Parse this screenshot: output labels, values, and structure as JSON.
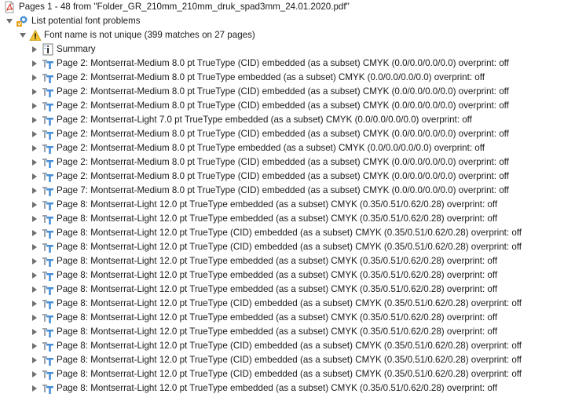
{
  "header": {
    "title": "Pages 1 - 48 from \"Folder_GR_210mm_210mm_druk_spad3mm_24.01.2020.pdf\""
  },
  "check": {
    "label": "List potential font problems"
  },
  "group": {
    "label": "Font name is not unique (399 matches on 27 pages)"
  },
  "summary": {
    "label": "Summary"
  },
  "items": [
    {
      "label": "Page 2: Montserrat-Medium 8.0 pt TrueType (CID)  embedded (as a subset) CMYK (0.0/0.0/0.0/0.0)  overprint: off"
    },
    {
      "label": "Page 2: Montserrat-Medium 8.0 pt TrueType  embedded (as a subset) CMYK (0.0/0.0/0.0/0.0)  overprint: off"
    },
    {
      "label": "Page 2: Montserrat-Medium 8.0 pt TrueType (CID)  embedded (as a subset) CMYK (0.0/0.0/0.0/0.0)  overprint: off"
    },
    {
      "label": "Page 2: Montserrat-Medium 8.0 pt TrueType (CID)  embedded (as a subset) CMYK (0.0/0.0/0.0/0.0)  overprint: off"
    },
    {
      "label": "Page 2: Montserrat-Light 7.0 pt TrueType  embedded (as a subset) CMYK (0.0/0.0/0.0/0.0)  overprint: off"
    },
    {
      "label": "Page 2: Montserrat-Medium 8.0 pt TrueType (CID)  embedded (as a subset) CMYK (0.0/0.0/0.0/0.0)  overprint: off"
    },
    {
      "label": "Page 2: Montserrat-Medium 8.0 pt TrueType  embedded (as a subset) CMYK (0.0/0.0/0.0/0.0)  overprint: off"
    },
    {
      "label": "Page 2: Montserrat-Medium 8.0 pt TrueType (CID)  embedded (as a subset) CMYK (0.0/0.0/0.0/0.0)  overprint: off"
    },
    {
      "label": "Page 2: Montserrat-Medium 8.0 pt TrueType (CID)  embedded (as a subset) CMYK (0.0/0.0/0.0/0.0)  overprint: off"
    },
    {
      "label": "Page 7: Montserrat-Medium 8.0 pt TrueType (CID)  embedded (as a subset) CMYK (0.0/0.0/0.0/0.0)  overprint: off"
    },
    {
      "label": "Page 8: Montserrat-Light 12.0 pt TrueType  embedded (as a subset) CMYK (0.35/0.51/0.62/0.28)  overprint: off"
    },
    {
      "label": "Page 8: Montserrat-Light 12.0 pt TrueType  embedded (as a subset) CMYK (0.35/0.51/0.62/0.28)  overprint: off"
    },
    {
      "label": "Page 8: Montserrat-Light 12.0 pt TrueType (CID)  embedded (as a subset) CMYK (0.35/0.51/0.62/0.28)  overprint: off"
    },
    {
      "label": "Page 8: Montserrat-Light 12.0 pt TrueType (CID)  embedded (as a subset) CMYK (0.35/0.51/0.62/0.28)  overprint: off"
    },
    {
      "label": "Page 8: Montserrat-Light 12.0 pt TrueType  embedded (as a subset) CMYK (0.35/0.51/0.62/0.28)  overprint: off"
    },
    {
      "label": "Page 8: Montserrat-Light 12.0 pt TrueType  embedded (as a subset) CMYK (0.35/0.51/0.62/0.28)  overprint: off"
    },
    {
      "label": "Page 8: Montserrat-Light 12.0 pt TrueType  embedded (as a subset) CMYK (0.35/0.51/0.62/0.28)  overprint: off"
    },
    {
      "label": "Page 8: Montserrat-Light 12.0 pt TrueType (CID)  embedded (as a subset) CMYK (0.35/0.51/0.62/0.28)  overprint: off"
    },
    {
      "label": "Page 8: Montserrat-Light 12.0 pt TrueType  embedded (as a subset) CMYK (0.35/0.51/0.62/0.28)  overprint: off"
    },
    {
      "label": "Page 8: Montserrat-Light 12.0 pt TrueType  embedded (as a subset) CMYK (0.35/0.51/0.62/0.28)  overprint: off"
    },
    {
      "label": "Page 8: Montserrat-Light 12.0 pt TrueType (CID)  embedded (as a subset) CMYK (0.35/0.51/0.62/0.28)  overprint: off"
    },
    {
      "label": "Page 8: Montserrat-Light 12.0 pt TrueType (CID)  embedded (as a subset) CMYK (0.35/0.51/0.62/0.28)  overprint: off"
    },
    {
      "label": "Page 8: Montserrat-Light 12.0 pt TrueType (CID)  embedded (as a subset) CMYK (0.35/0.51/0.62/0.28)  overprint: off"
    },
    {
      "label": "Page 8: Montserrat-Light 12.0 pt TrueType  embedded (as a subset) CMYK (0.35/0.51/0.62/0.28)  overprint: off"
    }
  ],
  "colors": {
    "triangle": "#6e6e6e",
    "pdf_red": "#d9301f",
    "warning_yellow": "#f2c230",
    "font_icon_blue": "#4a8fd6",
    "font_icon_gray": "#9aa3ad"
  },
  "icons": {
    "header": "pdf-file-icon",
    "check": "preflight-check-icon",
    "group": "warning-icon",
    "summary": "info-document-icon",
    "item": "font-icon"
  }
}
